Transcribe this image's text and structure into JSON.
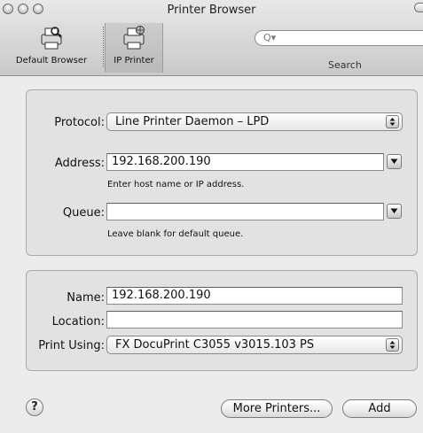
{
  "window": {
    "title": "Printer Browser"
  },
  "toolbar": {
    "default_browser_label": "Default Browser",
    "ip_printer_label": "IP Printer",
    "search_label": "Search",
    "search_placeholder": ""
  },
  "ip_panel": {
    "protocol_label": "Protocol:",
    "protocol_value": "Line Printer Daemon – LPD",
    "address_label": "Address:",
    "address_value": "192.168.200.190",
    "address_hint": "Enter host name or IP address.",
    "queue_label": "Queue:",
    "queue_value": "",
    "queue_hint": "Leave blank for default queue."
  },
  "printer_panel": {
    "name_label": "Name:",
    "name_value": "192.168.200.190",
    "location_label": "Location:",
    "location_value": "",
    "print_using_label": "Print Using:",
    "print_using_value": "FX DocuPrint C3055 v3015.103 PS"
  },
  "footer": {
    "help_label": "?",
    "more_printers_label": "More Printers...",
    "add_label": "Add"
  }
}
